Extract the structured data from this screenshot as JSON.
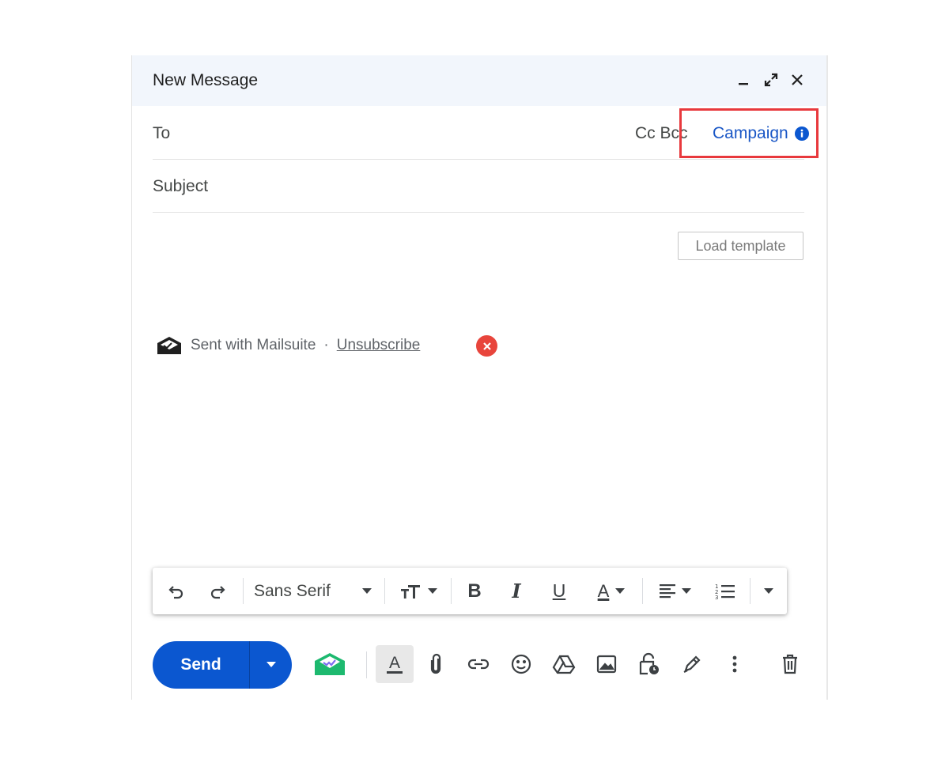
{
  "window": {
    "title": "New Message",
    "minimize_icon": "minimize-icon",
    "expand_icon": "expand-icon",
    "close_icon": "close-icon"
  },
  "recipients": {
    "to_label": "To",
    "cc_bcc_label": "Cc Bcc",
    "campaign_label": "Campaign",
    "campaign_info_icon": "info-icon"
  },
  "subject": {
    "placeholder": "Subject"
  },
  "body": {
    "load_template_label": "Load template",
    "signature": {
      "text": "Sent with Mailsuite",
      "separator": "·",
      "unsubscribe_label": "Unsubscribe"
    }
  },
  "formatting": {
    "font_name": "Sans Serif",
    "bold": "B",
    "italic": "I",
    "underline": "U",
    "text_color": "A"
  },
  "bottom_bar": {
    "send_label": "Send",
    "text_format_glyph": "A"
  },
  "colors": {
    "accent": "#0b57d0",
    "highlight_box": "#e8393d",
    "campaign_link": "#1a57c6",
    "mailsuite_green": "#1db96f"
  }
}
